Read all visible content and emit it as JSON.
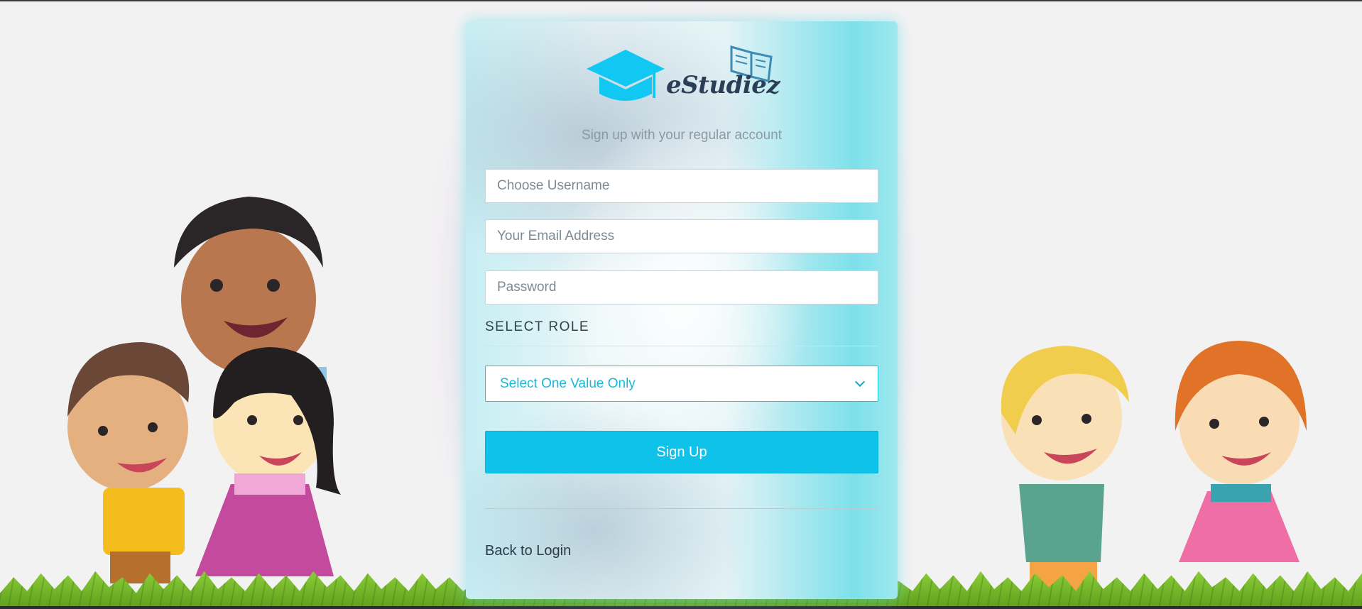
{
  "brand": {
    "name": "eStudiez"
  },
  "form": {
    "subtitle": "Sign up with your regular account",
    "username_placeholder": "Choose Username",
    "email_placeholder": "Your Email Address",
    "password_placeholder": "Password",
    "role_label": "SELECT ROLE",
    "role_selected": "Select One Value Only",
    "submit_label": "Sign Up",
    "back_link": "Back to Login"
  },
  "colors": {
    "accent": "#0ec2ea",
    "logo_cap": "#10c8f2",
    "logo_text": "#2a3e55",
    "background": "#f3f2f3"
  }
}
